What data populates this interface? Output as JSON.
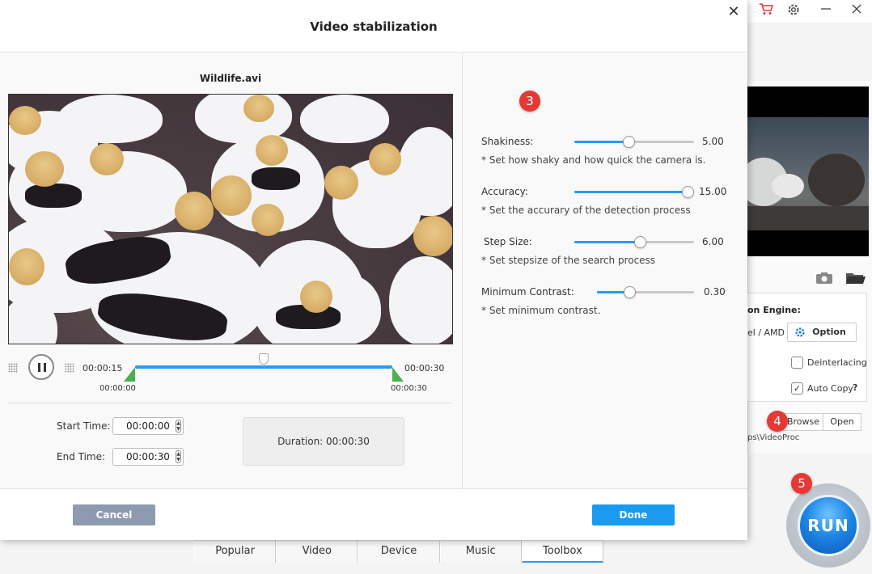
{
  "dialog": {
    "title": "Video stabilization",
    "file_name": "Wildlife.avi",
    "close_glyph": "✕"
  },
  "player": {
    "current_time": "00:00:15",
    "end_time_label": "00:00:30",
    "trim_start_label": "00:00:00",
    "trim_end_label": "00:00:30",
    "playhead_fraction": 0.5
  },
  "trim": {
    "start_time_label": "Start Time:",
    "start_time_value": "00:00:00",
    "end_time_label": "End Time:",
    "end_time_value": "00:00:30",
    "duration_text": "Duration:  00:00:30"
  },
  "params": [
    {
      "label": "Shakiness:",
      "value": "5.00",
      "hint": "* Set how shaky and how quick the camera is.",
      "fraction": 0.45
    },
    {
      "label": "Accuracy:",
      "value": "15.00",
      "hint": "* Set the accurary of the detection process",
      "fraction": 1.0
    },
    {
      "label": "Step Size:",
      "value": "6.00",
      "hint": "* Set stepsize of the search process",
      "fraction": 0.55
    },
    {
      "label": "Minimum Contrast:",
      "value": "0.30",
      "hint": "* Set minimum contrast.",
      "fraction": 0.33
    }
  ],
  "footer": {
    "cancel_label": "Cancel",
    "done_label": "Done"
  },
  "badges": {
    "step3": "3",
    "step4": "4",
    "step5": "5"
  },
  "app": {
    "engine_label": "on Engine:",
    "engine_vendor": "el / AMD",
    "option_label": "Option",
    "deinterlacing_label": "Deinterlacing",
    "auto_copy_label": "Auto Copy",
    "auto_copy_help": "?",
    "auto_copy_checked": true,
    "deinterlacing_checked": false,
    "browse_label": "Browse",
    "open_label": "Open",
    "output_path": "ps\\VideoProc",
    "run_label": "RUN",
    "tabs": [
      "Popular",
      "Video",
      "Device",
      "Music",
      "Toolbox"
    ],
    "active_tab": "Toolbox"
  },
  "colors": {
    "accent": "#2b9af3",
    "done": "#1a9bf0",
    "cancel": "#8d9ab0",
    "badge": "#e53935",
    "trim_handle": "#4caf50"
  },
  "icons": [
    "cart-icon",
    "gear-icon",
    "minimize-icon",
    "close-icon",
    "camera-icon",
    "folder-icon",
    "pause-icon"
  ]
}
